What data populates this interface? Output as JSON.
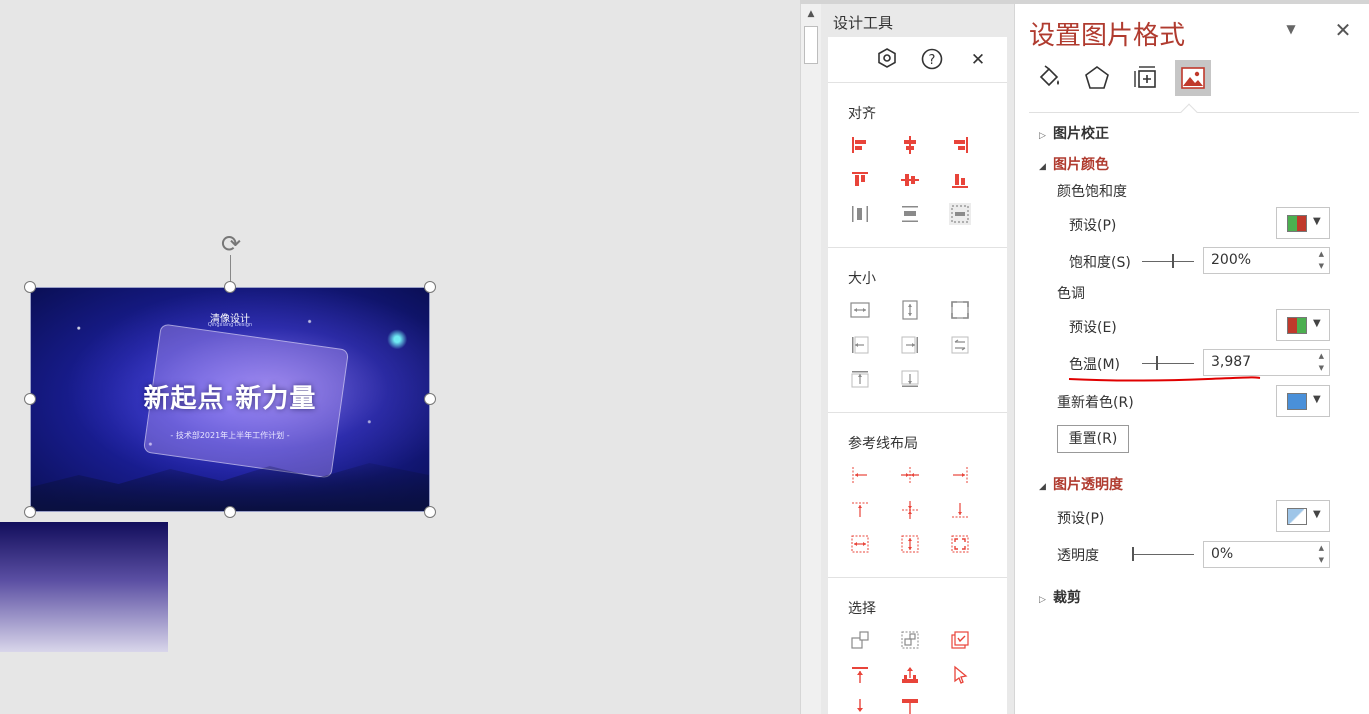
{
  "slide": {
    "brand": "清像设计",
    "brand_sub": "Qingxiang Design",
    "title": "新起点·新力量",
    "subtitle": "- 技术部2021年上半年工作计划 -"
  },
  "design_tools": {
    "title": "设计工具",
    "sections": [
      "对齐",
      "大小",
      "参考线布局",
      "选择"
    ]
  },
  "format_pane": {
    "title": "设置图片格式",
    "sections": {
      "correction": "图片校正",
      "color": "图片颜色",
      "transparency": "图片透明度",
      "crop": "裁剪"
    },
    "color": {
      "saturation_group": "颜色饱和度",
      "saturation_preset_label": "预设(P)",
      "saturation_label": "饱和度(S)",
      "saturation_value": "200%",
      "saturation_level": 1.0,
      "tone_group": "色调",
      "tone_preset_label": "预设(E)",
      "temperature_label": "色温(M)",
      "temperature_value": "3,987",
      "recolor_label": "重新着色(R)",
      "reset_label": "重置(R)"
    },
    "transparency": {
      "preset_label": "预设(P)",
      "transparency_label": "透明度",
      "transparency_value": "0%"
    }
  },
  "colors": {
    "accent": "#b03b2f",
    "icon_red": "#e8443a",
    "icon_gray": "#8a8a8a"
  }
}
